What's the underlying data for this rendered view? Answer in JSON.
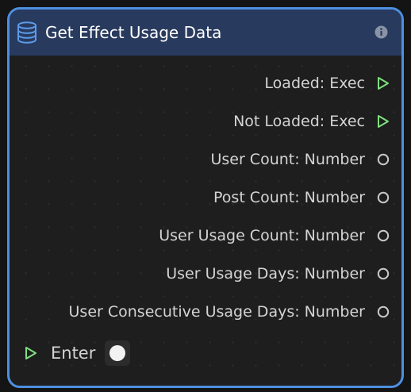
{
  "node": {
    "title": "Get Effect Usage Data",
    "header_icon": "database-icon",
    "info_icon": "info-icon",
    "colors": {
      "border": "#4d8fe0",
      "header_bg": "#283a5e",
      "body_bg": "#1e1e1e",
      "exec_pin": "#7fe07f",
      "value_pin": "#c8c8c8"
    }
  },
  "outputs": [
    {
      "label": "Loaded: Exec",
      "pin_type": "exec"
    },
    {
      "label": "Not Loaded: Exec",
      "pin_type": "exec"
    },
    {
      "label": "User Count: Number",
      "pin_type": "value"
    },
    {
      "label": "Post Count: Number",
      "pin_type": "value"
    },
    {
      "label": "User Usage Count: Number",
      "pin_type": "value"
    },
    {
      "label": "User Usage Days: Number",
      "pin_type": "value"
    },
    {
      "label": "User Consecutive Usage Days: Number",
      "pin_type": "value"
    }
  ],
  "input": {
    "label": "Enter",
    "pin_type": "exec",
    "toggle_state": "on"
  }
}
